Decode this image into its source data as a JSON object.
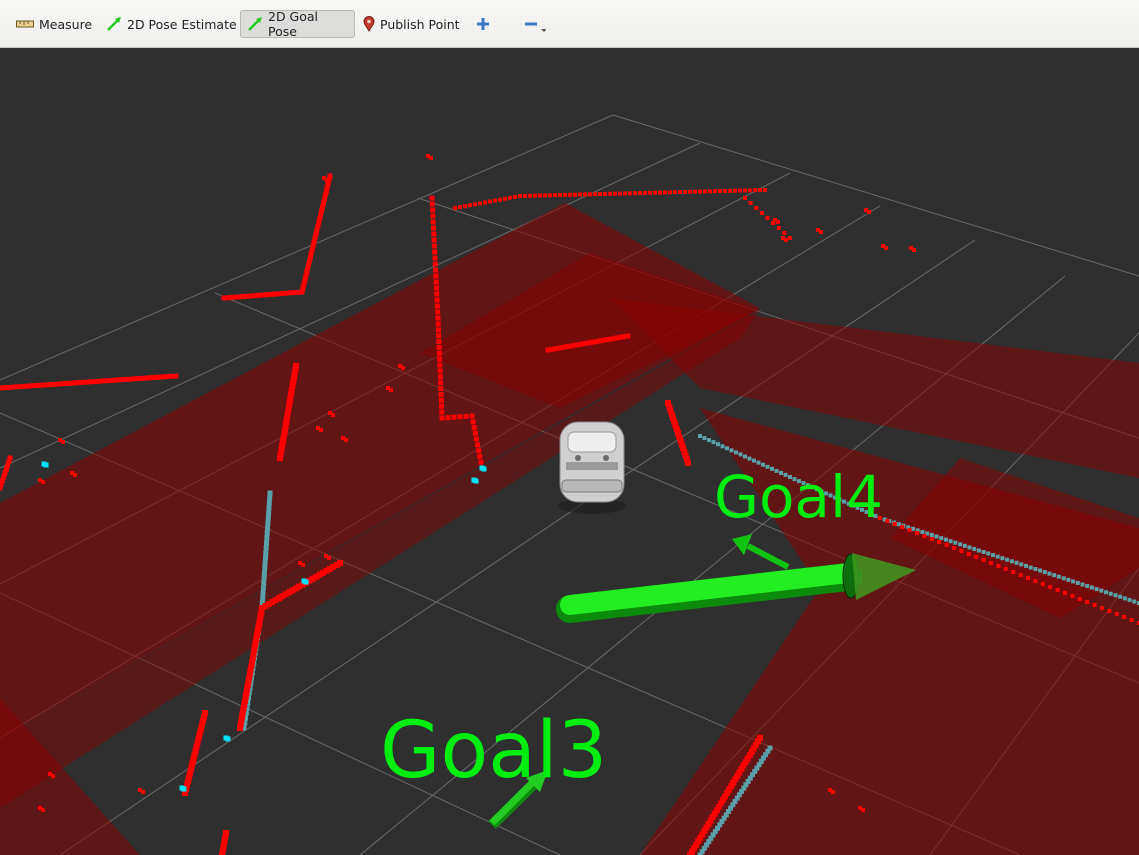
{
  "toolbar": {
    "tools": [
      {
        "id": "measure",
        "label": "Measure",
        "icon": "ruler-icon",
        "active": false
      },
      {
        "id": "pose_estimate",
        "label": "2D Pose Estimate",
        "icon": "green-arrow-icon",
        "active": false
      },
      {
        "id": "goal_pose",
        "label": "2D Goal Pose",
        "icon": "green-arrow-icon",
        "active": true
      },
      {
        "id": "publish_point",
        "label": "Publish Point",
        "icon": "map-pin-icon",
        "active": false
      }
    ],
    "add_icon": "plus-icon",
    "remove_icon": "minus-icon"
  },
  "scene": {
    "goals": [
      {
        "name": "Goal4"
      },
      {
        "name": "Goal3"
      }
    ],
    "colors": {
      "background": "#2f2f2f",
      "grid": "#9a9a9a",
      "costmap": "#8b0000",
      "laser": "#ff0000",
      "laser_alt": "#5aa0a8",
      "laser_highlight": "#00e5ff",
      "goal": "#00ee10",
      "robot": "#d8d8d8"
    }
  }
}
